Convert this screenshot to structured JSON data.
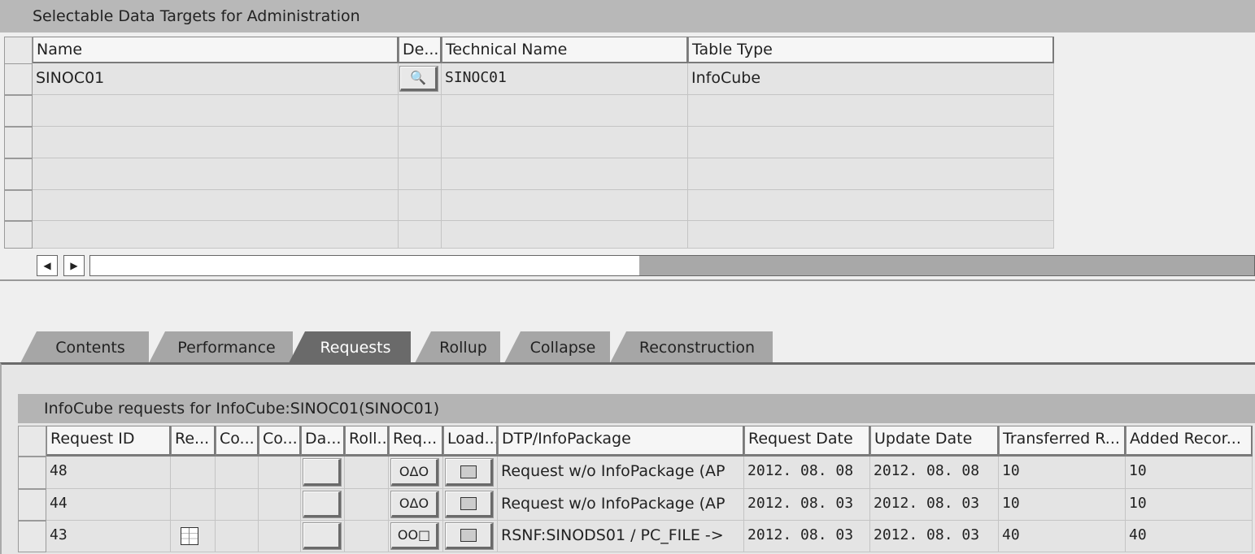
{
  "targets": {
    "title": "Selectable Data Targets for Administration",
    "columns": [
      "Name",
      "De...",
      "Technical Name",
      "Table Type"
    ],
    "rows": [
      {
        "name": "SINOC01",
        "detail_icon": "magnifier-icon",
        "technical_name": "SINOC01",
        "table_type": "InfoCube"
      }
    ],
    "empty_rows": 5
  },
  "tabs": [
    {
      "label": "Contents",
      "active": false
    },
    {
      "label": "Performance",
      "active": false
    },
    {
      "label": "Requests",
      "active": true
    },
    {
      "label": "Rollup",
      "active": false
    },
    {
      "label": "Collapse",
      "active": false
    },
    {
      "label": "Reconstruction",
      "active": false
    }
  ],
  "requests": {
    "title": "InfoCube requests for InfoCube:SINOC01(SINOC01)",
    "columns": [
      "Request ID",
      "Re...",
      "Co...",
      "Co...",
      "Da...",
      "Roll...",
      "Req...",
      "Load...",
      "DTP/InfoPackage",
      "Request Date",
      "Update Date",
      "Transferred R...",
      "Added Recor..."
    ],
    "rows": [
      {
        "id": "48",
        "re_icon": "",
        "req_status": "ΟΔΟ",
        "req_icon": "status-lights-icon",
        "dtp": "Request w/o InfoPackage (AP",
        "request_date": "2012. 08. 08",
        "update_date": "2012. 08. 08",
        "transferred": "10",
        "added": "10"
      },
      {
        "id": "44",
        "re_icon": "",
        "req_status": "ΟΔΟ",
        "req_icon": "status-lights-icon",
        "dtp": "Request w/o InfoPackage (AP",
        "request_date": "2012. 08. 03",
        "update_date": "2012. 08. 03",
        "transferred": "10",
        "added": "10"
      },
      {
        "id": "43",
        "re_icon": "table-icon",
        "req_status": "ΟΟ□",
        "req_icon": "status-lights-icon",
        "dtp": "RSNF:SINODS01 / PC_FILE ->",
        "request_date": "2012. 08. 03",
        "update_date": "2012. 08. 03",
        "transferred": "40",
        "added": "40"
      }
    ]
  }
}
